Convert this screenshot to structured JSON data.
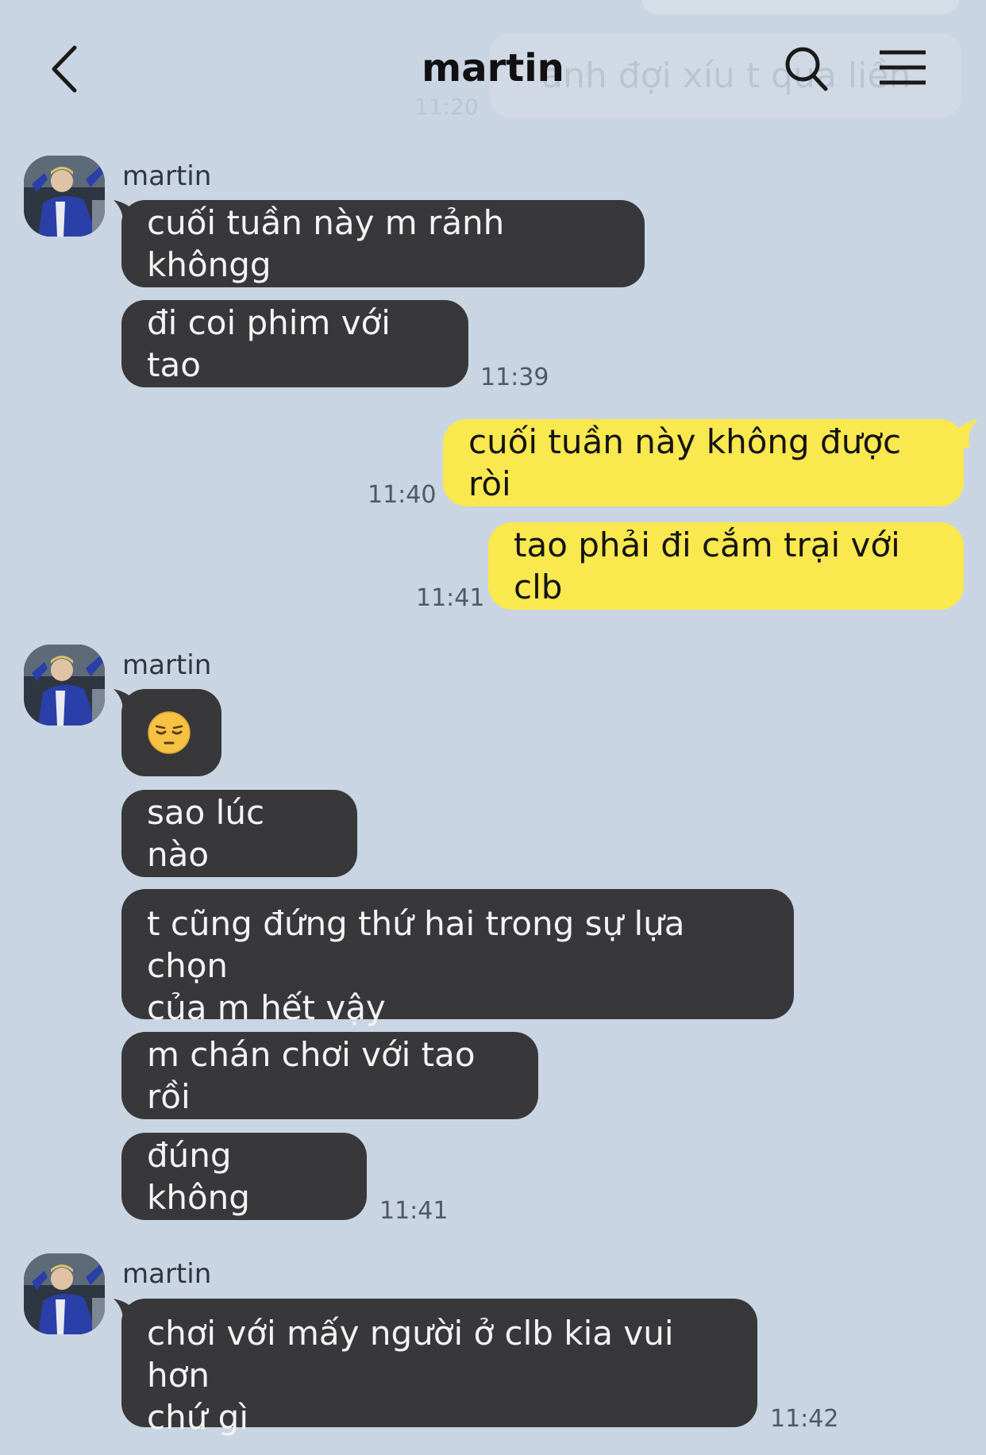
{
  "header": {
    "title": "martin",
    "back_icon": "chevron-left-icon",
    "search_icon": "search-icon",
    "menu_icon": "hamburger-menu-icon"
  },
  "background_preview": {
    "text": "anh đợi xíu t qua liền",
    "time": "11:20"
  },
  "colors": {
    "background": "#c9d5e2",
    "incoming": "#38383b",
    "outgoing": "#fae84f"
  },
  "messages": [
    {
      "sender": "martin",
      "text": "cuối tuần này m rảnh khôngg"
    },
    {
      "text": "đi coi phim với tao",
      "time": "11:39"
    },
    {
      "text": "cuối tuần này không được ròi",
      "time": "11:40"
    },
    {
      "text": "tao phải đi cắm trại với clb",
      "time": "11:41"
    },
    {
      "sender": "martin",
      "emoji": "pensive-face-emoji"
    },
    {
      "text": "sao lúc nào"
    },
    {
      "text_line1": "t cũng đứng thứ hai trong sự lựa chọn",
      "text_line2": "của m hết vậy"
    },
    {
      "text": "m chán chơi với tao rồi"
    },
    {
      "text": "đúng không",
      "time": "11:41"
    },
    {
      "sender": "martin",
      "text_line1": "chơi với mấy người ở clb kia vui hơn",
      "text_line2": "chứ gì",
      "time": "11:42"
    }
  ]
}
